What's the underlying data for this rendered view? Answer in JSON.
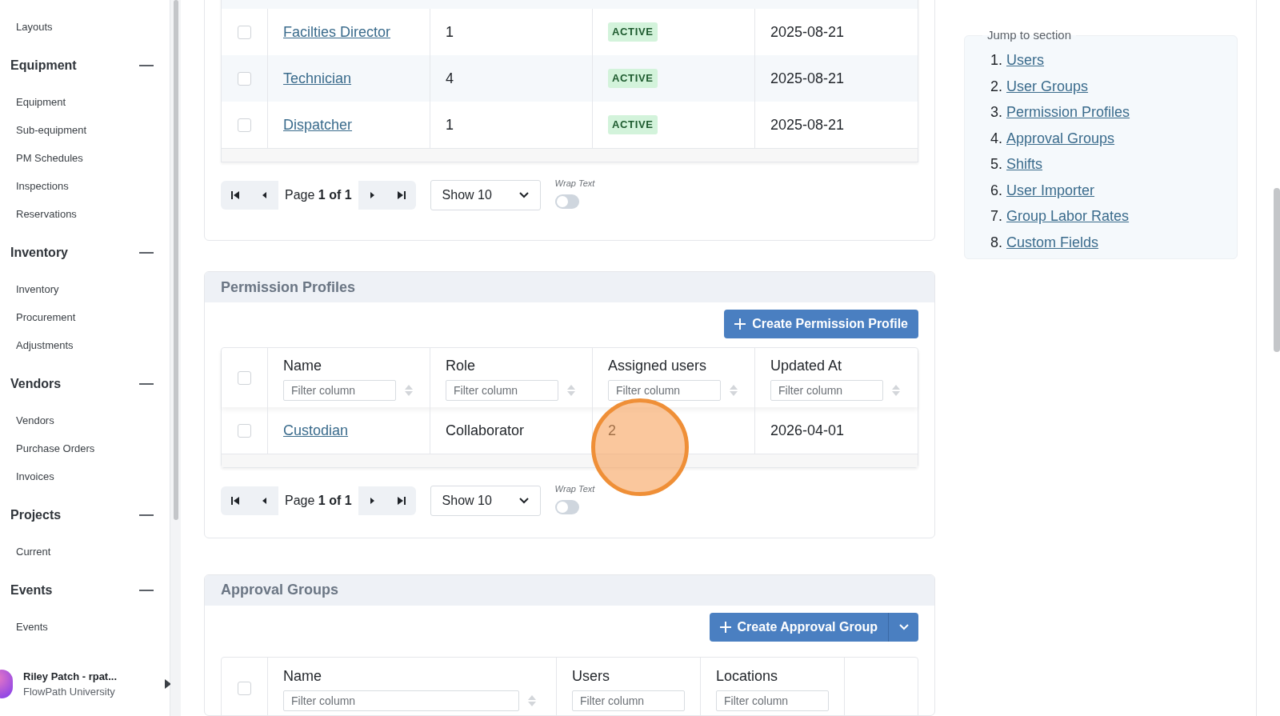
{
  "sidebar": {
    "top_items": [
      "Layouts"
    ],
    "groups": [
      {
        "label": "Equipment",
        "expanded": true,
        "items": [
          "Equipment",
          "Sub-equipment",
          "PM Schedules",
          "Inspections",
          "Reservations"
        ]
      },
      {
        "label": "Inventory",
        "expanded": true,
        "items": [
          "Inventory",
          "Procurement",
          "Adjustments"
        ]
      },
      {
        "label": "Vendors",
        "expanded": true,
        "items": [
          "Vendors",
          "Purchase Orders",
          "Invoices"
        ]
      },
      {
        "label": "Projects",
        "expanded": true,
        "items": [
          "Current"
        ]
      },
      {
        "label": "Events",
        "expanded": true,
        "items": [
          "Events"
        ]
      }
    ],
    "user": {
      "name": "Riley Patch - rpat...",
      "organization": "FlowPath University"
    }
  },
  "user_groups_table": {
    "rows": [
      {
        "name": "Facilties Director",
        "count": "1",
        "status": "ACTIVE",
        "date": "2025-08-21",
        "selected": false
      },
      {
        "name": "Technician",
        "count": "4",
        "status": "ACTIVE",
        "date": "2025-08-21",
        "selected": false
      },
      {
        "name": "Dispatcher",
        "count": "1",
        "status": "ACTIVE",
        "date": "2025-08-21",
        "selected": false
      }
    ],
    "pager": {
      "page": "Page **1 of 1**",
      "page_size": "Show 10",
      "wrap_label": "Wrap Text",
      "wrap_on": false
    }
  },
  "permission_profiles": {
    "title": "Permission Profiles",
    "create_button": "Create Permission Profile",
    "header_selected": false,
    "columns": [
      {
        "label": "Name",
        "filter_placeholder": "Filter column"
      },
      {
        "label": "Role",
        "filter_placeholder": "Filter column"
      },
      {
        "label": "Assigned users",
        "filter_placeholder": "Filter column"
      },
      {
        "label": "Updated At",
        "filter_placeholder": "Filter column"
      }
    ],
    "rows": [
      {
        "cells": [
          "Custodian",
          "Collaborator",
          "2",
          "2026-04-01"
        ],
        "selected": false
      }
    ],
    "pager": {
      "page": "Page **1 of 1**",
      "page_size": "Show 10",
      "wrap_label": "Wrap Text",
      "wrap_on": false
    }
  },
  "approval_groups": {
    "title": "Approval Groups",
    "create_button": "Create Approval Group",
    "header_selected": false,
    "columns": [
      {
        "label": "Name",
        "filter_placeholder": "Filter column",
        "sortable": true
      },
      {
        "label": "Users",
        "filter_placeholder": "Filter column",
        "sortable": false
      },
      {
        "label": "Locations",
        "filter_placeholder": "Filter column",
        "sortable": false
      }
    ]
  },
  "jump_to_section": {
    "title": "Jump to section",
    "items": [
      {
        "number": "1.",
        "label": "Users"
      },
      {
        "number": "2.",
        "label": "User Groups"
      },
      {
        "number": "3.",
        "label": "Permission Profiles"
      },
      {
        "number": "4.",
        "label": "Approval Groups"
      },
      {
        "number": "5.",
        "label": "Shifts"
      },
      {
        "number": "6.",
        "label": "User Importer"
      },
      {
        "number": "7.",
        "label": "Group Labor Rates"
      },
      {
        "number": "8.",
        "label": "Custom Fields"
      }
    ]
  }
}
